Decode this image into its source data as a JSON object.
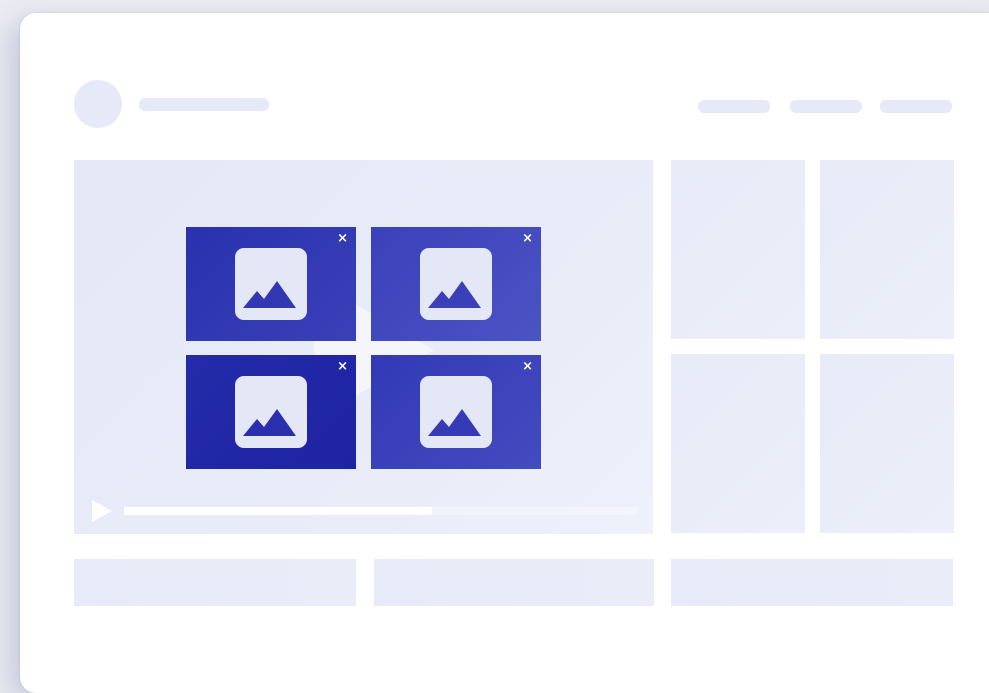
{
  "header": {
    "avatar_icon": "avatar-placeholder",
    "title_placeholder": "",
    "nav_items": [
      "",
      "",
      ""
    ]
  },
  "player": {
    "big_play_icon": "play-icon",
    "progress": 0.6,
    "play_icon": "play-icon"
  },
  "popup_tiles": [
    {
      "icon": "image-icon",
      "close_label": "×"
    },
    {
      "icon": "image-icon",
      "close_label": "×"
    },
    {
      "icon": "image-icon",
      "close_label": "×"
    },
    {
      "icon": "image-icon",
      "close_label": "×"
    }
  ],
  "colors": {
    "tile_gradient_dark": "#1f26a6",
    "tile_gradient_light": "#4a51c2",
    "placeholder": "#e8ebf7",
    "card_bg": "#ffffff",
    "page_bg": "#ecedf3"
  },
  "sidebar_thumbnails": 4,
  "bottom_blocks": 3
}
